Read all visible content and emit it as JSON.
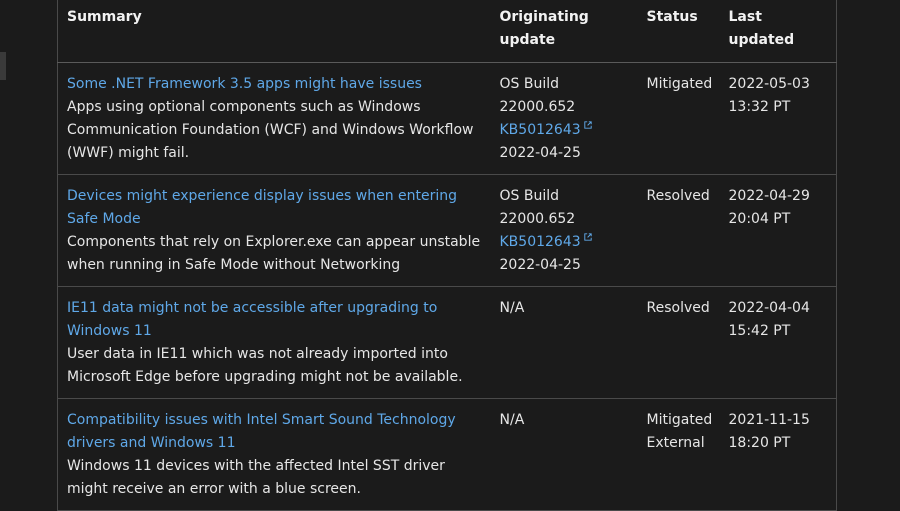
{
  "headers": {
    "summary": "Summary",
    "originating_update": "Originating update",
    "status": "Status",
    "last_updated": "Last updated"
  },
  "rows": [
    {
      "title": "Some .NET Framework 3.5 apps might have issues",
      "description": "Apps using optional components such as Windows Communication Foundation (WCF) and Windows Workflow (WWF) might fail.",
      "build": "OS Build 22000.652",
      "kb": "KB5012643",
      "date": "2022-04-25",
      "status": "Mitigated",
      "updated_date": "2022-05-03",
      "updated_time": "13:32 PT"
    },
    {
      "title": "Devices might experience display issues when entering Safe Mode",
      "description": "Components that rely on Explorer.exe can appear unstable when running in Safe Mode without Networking",
      "build": "OS Build 22000.652",
      "kb": "KB5012643",
      "date": "2022-04-25",
      "status": "Resolved",
      "updated_date": "2022-04-29",
      "updated_time": "20:04 PT"
    },
    {
      "title": "IE11 data might not be accessible after upgrading to Windows 11",
      "description": "User data in IE11 which was not already imported into Microsoft Edge before upgrading might not be available.",
      "build": "N/A",
      "status": "Resolved",
      "updated_date": "2022-04-04",
      "updated_time": "15:42 PT"
    },
    {
      "title": "Compatibility issues with Intel Smart Sound Technology drivers and Windows 11",
      "description": "Windows 11 devices with the affected Intel SST driver might receive an error with a blue screen.",
      "build": "N/A",
      "status": "Mitigated External",
      "updated_date": "2021-11-15",
      "updated_time": "18:20 PT"
    }
  ],
  "icons": {
    "external_link": "external-link-icon"
  },
  "colors": {
    "background": "#1b1b1b",
    "link": "#5fa8e8",
    "text": "#e6e6e6"
  }
}
